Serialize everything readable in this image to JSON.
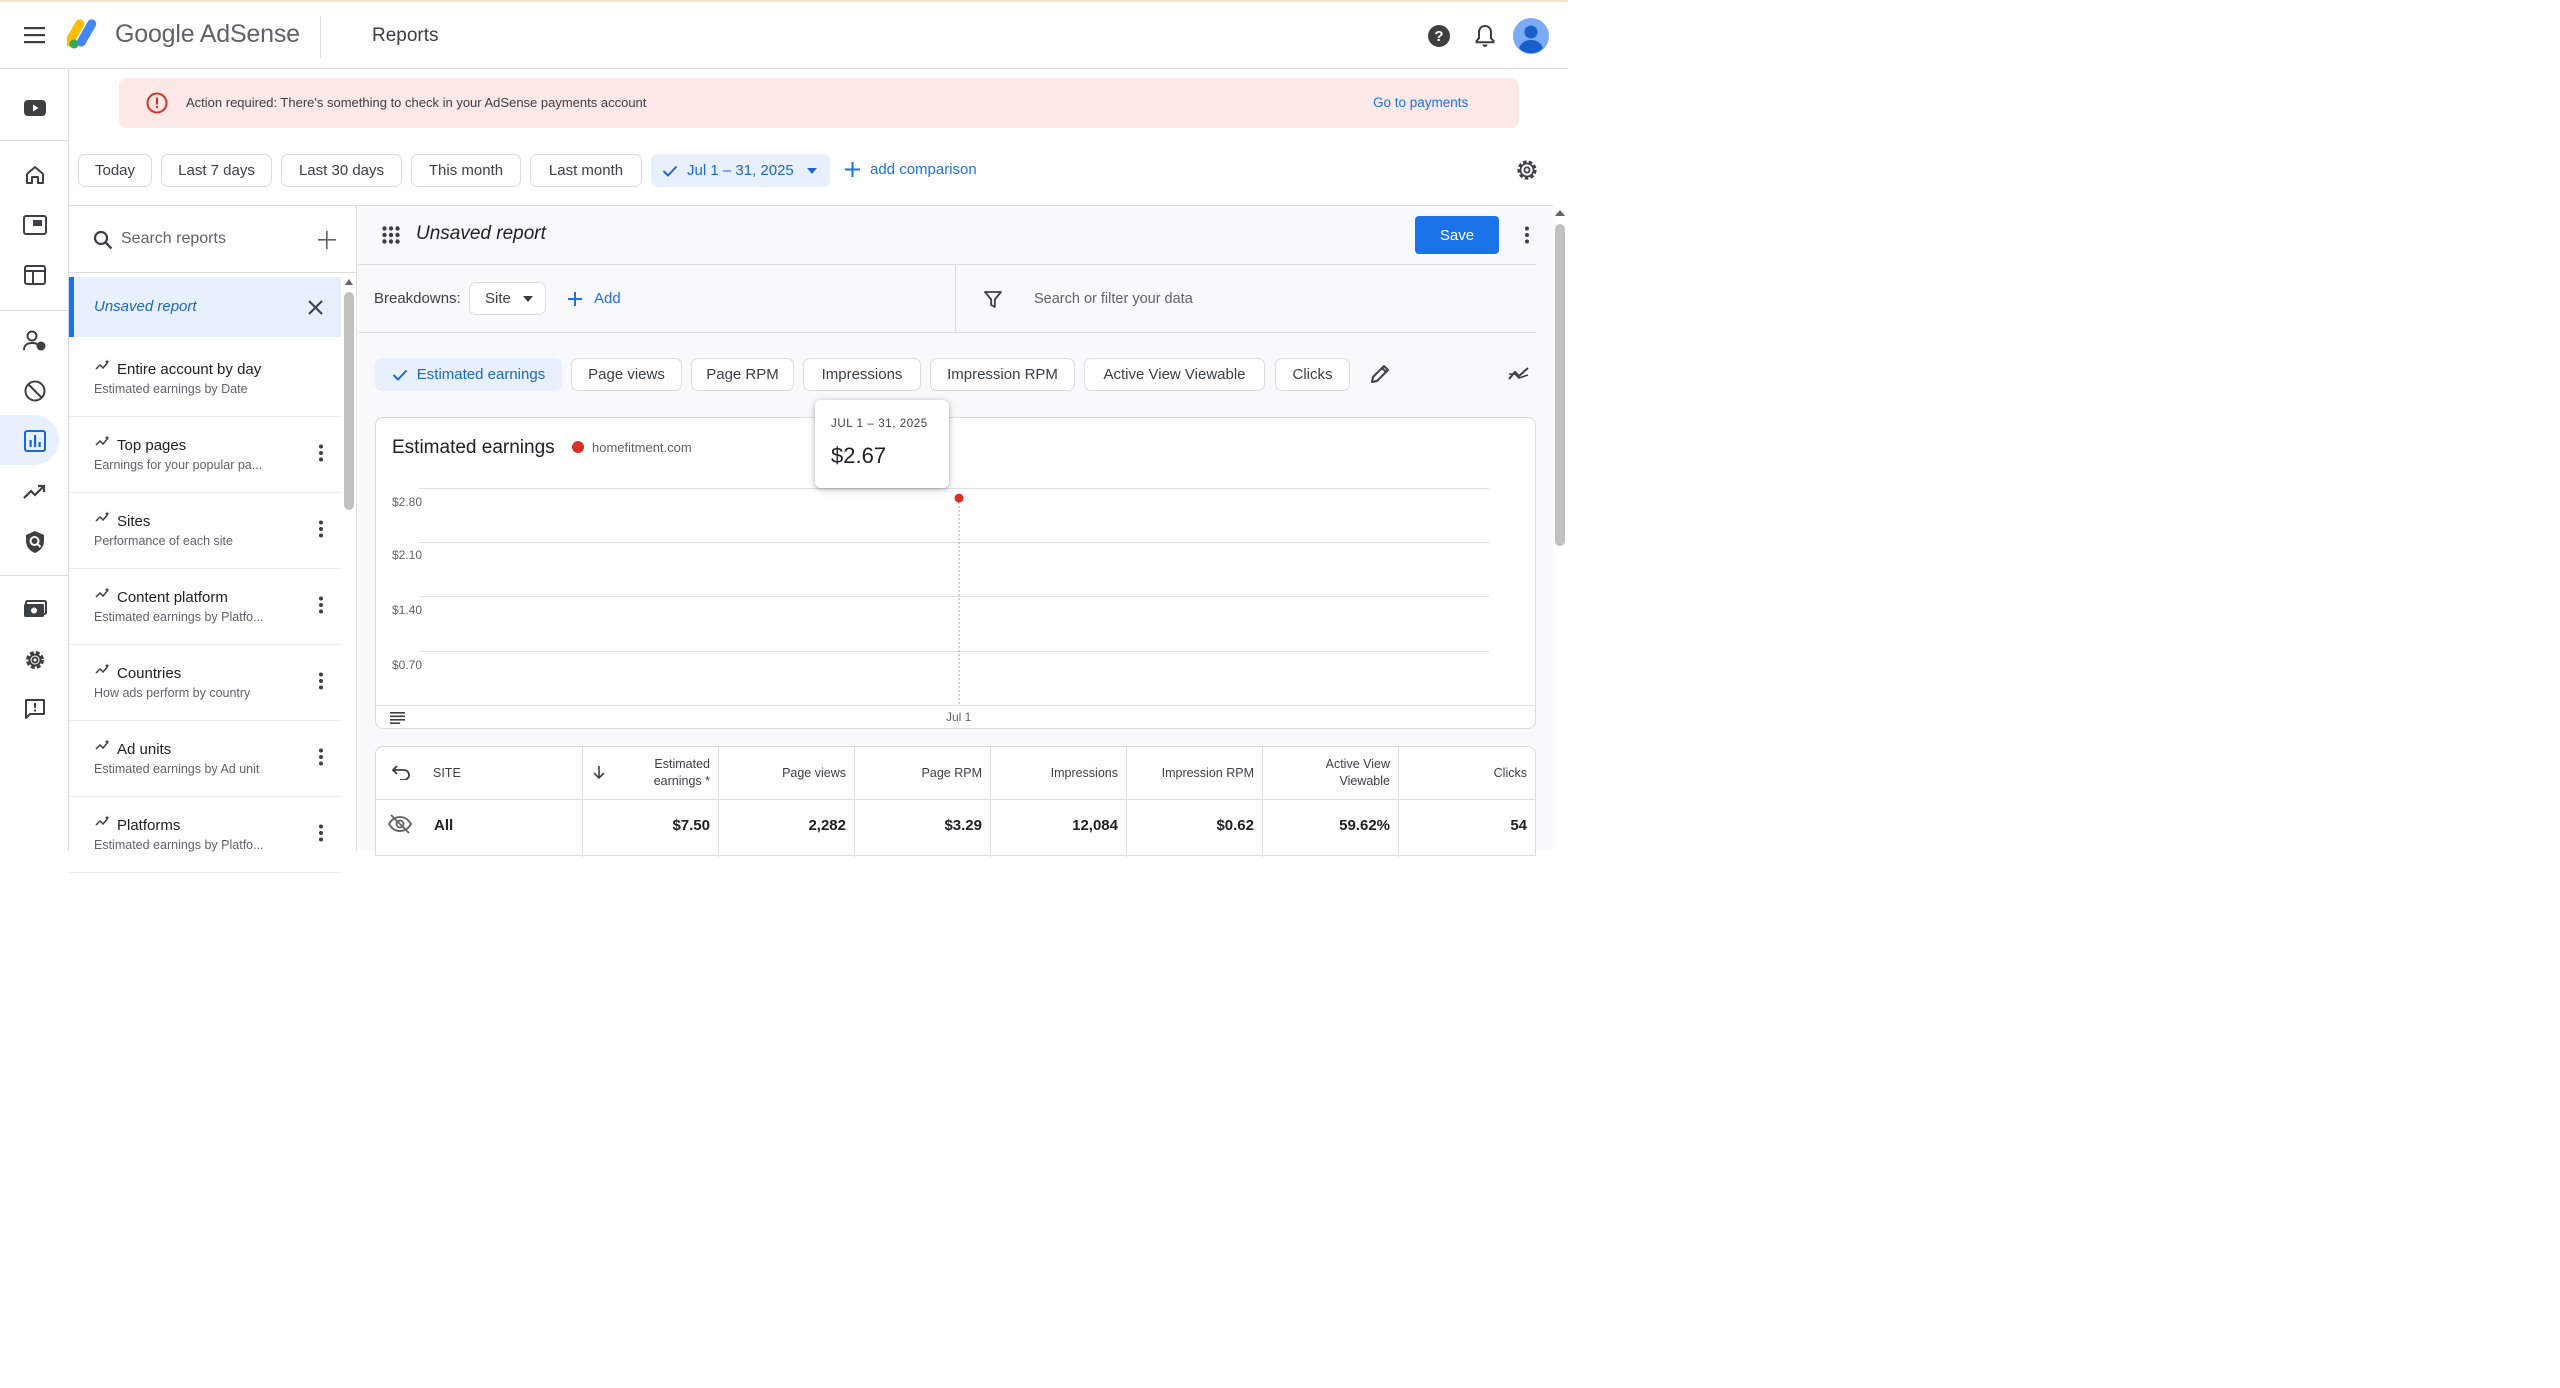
{
  "header": {
    "app_name": "Google AdSense",
    "page_title": "Reports"
  },
  "banner": {
    "message": "Action required: There's something to check in your AdSense payments account",
    "link": "Go to payments"
  },
  "date_range": {
    "presets": [
      "Today",
      "Last 7 days",
      "Last 30 days",
      "This month",
      "Last month"
    ],
    "selected": "Jul 1 – 31, 2025",
    "add_comparison": "add comparison"
  },
  "reports_sidebar": {
    "search_placeholder": "Search reports",
    "active": "Unsaved report",
    "items": [
      {
        "title": "Entire account by day",
        "subtitle": "Estimated earnings by Date"
      },
      {
        "title": "Top pages",
        "subtitle": "Earnings for your popular pa..."
      },
      {
        "title": "Sites",
        "subtitle": "Performance of each site"
      },
      {
        "title": "Content platform",
        "subtitle": "Estimated earnings by Platfo..."
      },
      {
        "title": "Countries",
        "subtitle": "How ads perform by country"
      },
      {
        "title": "Ad units",
        "subtitle": "Estimated earnings by Ad unit"
      },
      {
        "title": "Platforms",
        "subtitle": "Estimated earnings by Platfo..."
      }
    ]
  },
  "report": {
    "title": "Unsaved report",
    "save": "Save",
    "breakdowns_label": "Breakdowns:",
    "breakdown_value": "Site",
    "add": "Add",
    "filter_placeholder": "Search or filter your data",
    "metrics": [
      "Estimated earnings",
      "Page views",
      "Page RPM",
      "Impressions",
      "Impression RPM",
      "Active View Viewable",
      "Clicks"
    ],
    "selected_metric": "Estimated earnings"
  },
  "tooltip": {
    "date": "JUL 1 – 31, 2025",
    "value": "$2.67"
  },
  "chart_data": {
    "type": "line",
    "title": "Estimated earnings",
    "legend": "homefitment.com",
    "series_color": "#d93025",
    "x": [
      "Jul 1"
    ],
    "series": [
      {
        "name": "homefitment.com",
        "values": [
          2.67
        ]
      }
    ],
    "y_ticks": [
      "$2.80",
      "$2.10",
      "$1.40",
      "$0.70"
    ],
    "ylim": [
      0,
      2.8
    ],
    "grid": true
  },
  "table": {
    "columns": [
      "SITE",
      "Estimated earnings *",
      "Page views",
      "Page RPM",
      "Impressions",
      "Impression RPM",
      "Active View Viewable",
      "Clicks"
    ],
    "rows": [
      {
        "site": "All",
        "estimated_earnings": "$7.50",
        "page_views": "2,282",
        "page_rpm": "$3.29",
        "impressions": "12,084",
        "impression_rpm": "$0.62",
        "active_view": "59.62%",
        "clicks": "54"
      }
    ]
  }
}
